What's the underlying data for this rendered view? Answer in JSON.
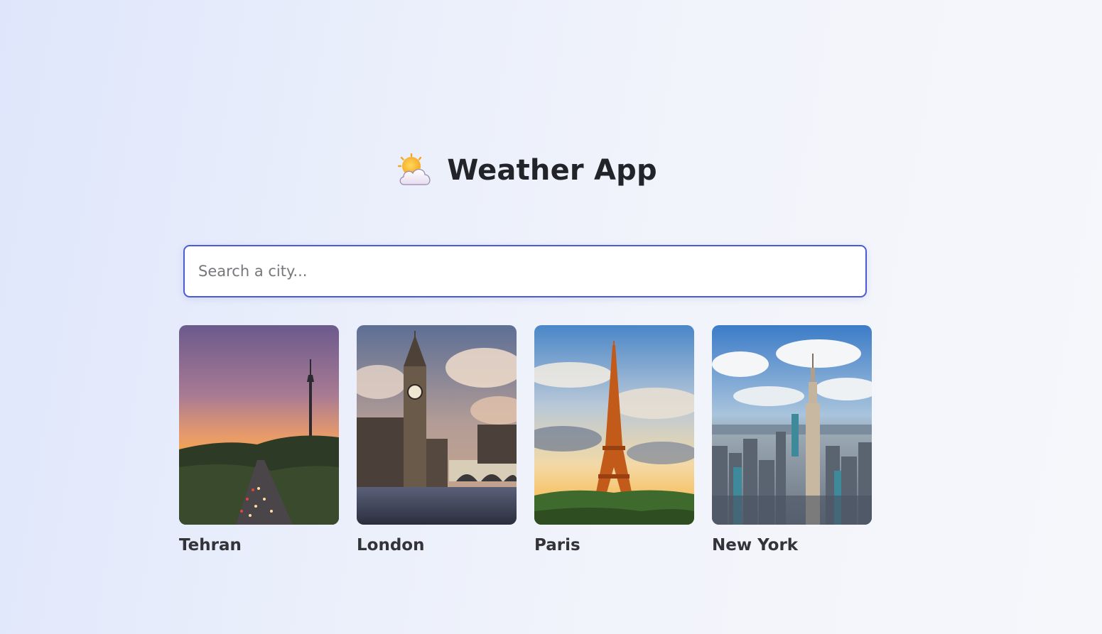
{
  "app": {
    "title": "Weather App",
    "logo_icon": "sun-behind-cloud-icon"
  },
  "search": {
    "placeholder": "Search a city...",
    "value": "",
    "border_color": "#4b5bd8"
  },
  "cities": [
    {
      "name": "Tehran",
      "image": "tehran-milad-tower-sunset-image"
    },
    {
      "name": "London",
      "image": "london-big-ben-image"
    },
    {
      "name": "Paris",
      "image": "paris-eiffel-tower-image"
    },
    {
      "name": "New York",
      "image": "new-york-empire-state-image"
    }
  ]
}
